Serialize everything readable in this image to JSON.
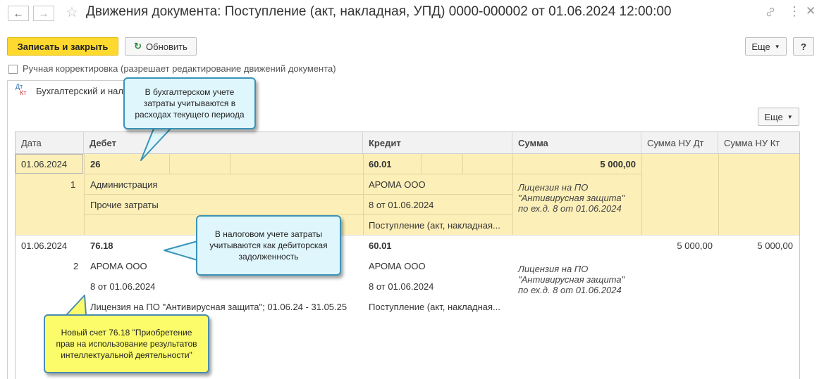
{
  "header": {
    "title": "Движения документа: Поступление (акт, накладная, УПД) 0000-000002 от 01.06.2024 12:00:00",
    "nav_back_icon": "←",
    "nav_forward_icon": "→",
    "star_icon": "☆",
    "link_icon": "🔗",
    "more_icon": "⋮",
    "close_icon": "✕"
  },
  "toolbar": {
    "save_close": "Записать и закрыть",
    "refresh": "Обновить",
    "refresh_icon": "↻",
    "more": "Еще",
    "help": "?"
  },
  "manual": {
    "label": "Ручная корректировка (разрешает редактирование движений документа)"
  },
  "tab": {
    "icon_top": "Дт",
    "icon_bottom": "Кт",
    "label": "Бухгалтерский и нал"
  },
  "grid_toolbar": {
    "more": "Еще"
  },
  "table": {
    "columns": [
      "Дата",
      "Дебет",
      "Кредит",
      "Сумма",
      "Сумма НУ Дт",
      "Сумма НУ Кт"
    ],
    "rows": [
      {
        "date": "01.06.2024",
        "num": "1",
        "debit_account": "26",
        "debit_sub1": "Администрация",
        "debit_sub2": "Прочие затраты",
        "debit_sub3": "",
        "credit_account": "60.01",
        "credit_sub1": "АРОМА ООО",
        "credit_sub2": "8 от 01.06.2024",
        "credit_sub3": "Поступление (акт, накладная...",
        "sum": "5 000,00",
        "content_line1": "Лицензия на ПО",
        "content_line2": "\"Антивирусная защита\"",
        "content_line3": "по ех.д. 8 от 01.06.2024",
        "nu_dt": "",
        "nu_kt": ""
      },
      {
        "date": "01.06.2024",
        "num": "2",
        "debit_account": "76.18",
        "debit_sub1": "АРОМА ООО",
        "debit_sub2": "8 от 01.06.2024",
        "debit_sub3": "Лицензия на ПО \"Антивирусная защита\"; 01.06.24 - 31.05.25",
        "credit_account": "60.01",
        "credit_sub1": "АРОМА ООО",
        "credit_sub2": "8 от 01.06.2024",
        "credit_sub3": "Поступление (акт, накладная...",
        "sum": "",
        "content_line1": "Лицензия на ПО",
        "content_line2": "\"Антивирусная защита\"",
        "content_line3": "по ех.д. 8 от 01.06.2024",
        "nu_dt": "5 000,00",
        "nu_kt": "5 000,00"
      }
    ]
  },
  "callouts": {
    "c1": "В бухгалтерском учете затраты учитываются в расходах текущего периода",
    "c2": "В налоговом учете затраты учитываются как дебиторская задолженность",
    "c3": "Новый счет 76.18 \"Приобретение прав на использование результатов интеллектуальной деятельности\""
  },
  "colors": {
    "primary_button": "#ffd92e",
    "selected_row": "#fcefb8",
    "callout_blue": "#dff6fd",
    "callout_yellow": "#fcfc6a"
  }
}
